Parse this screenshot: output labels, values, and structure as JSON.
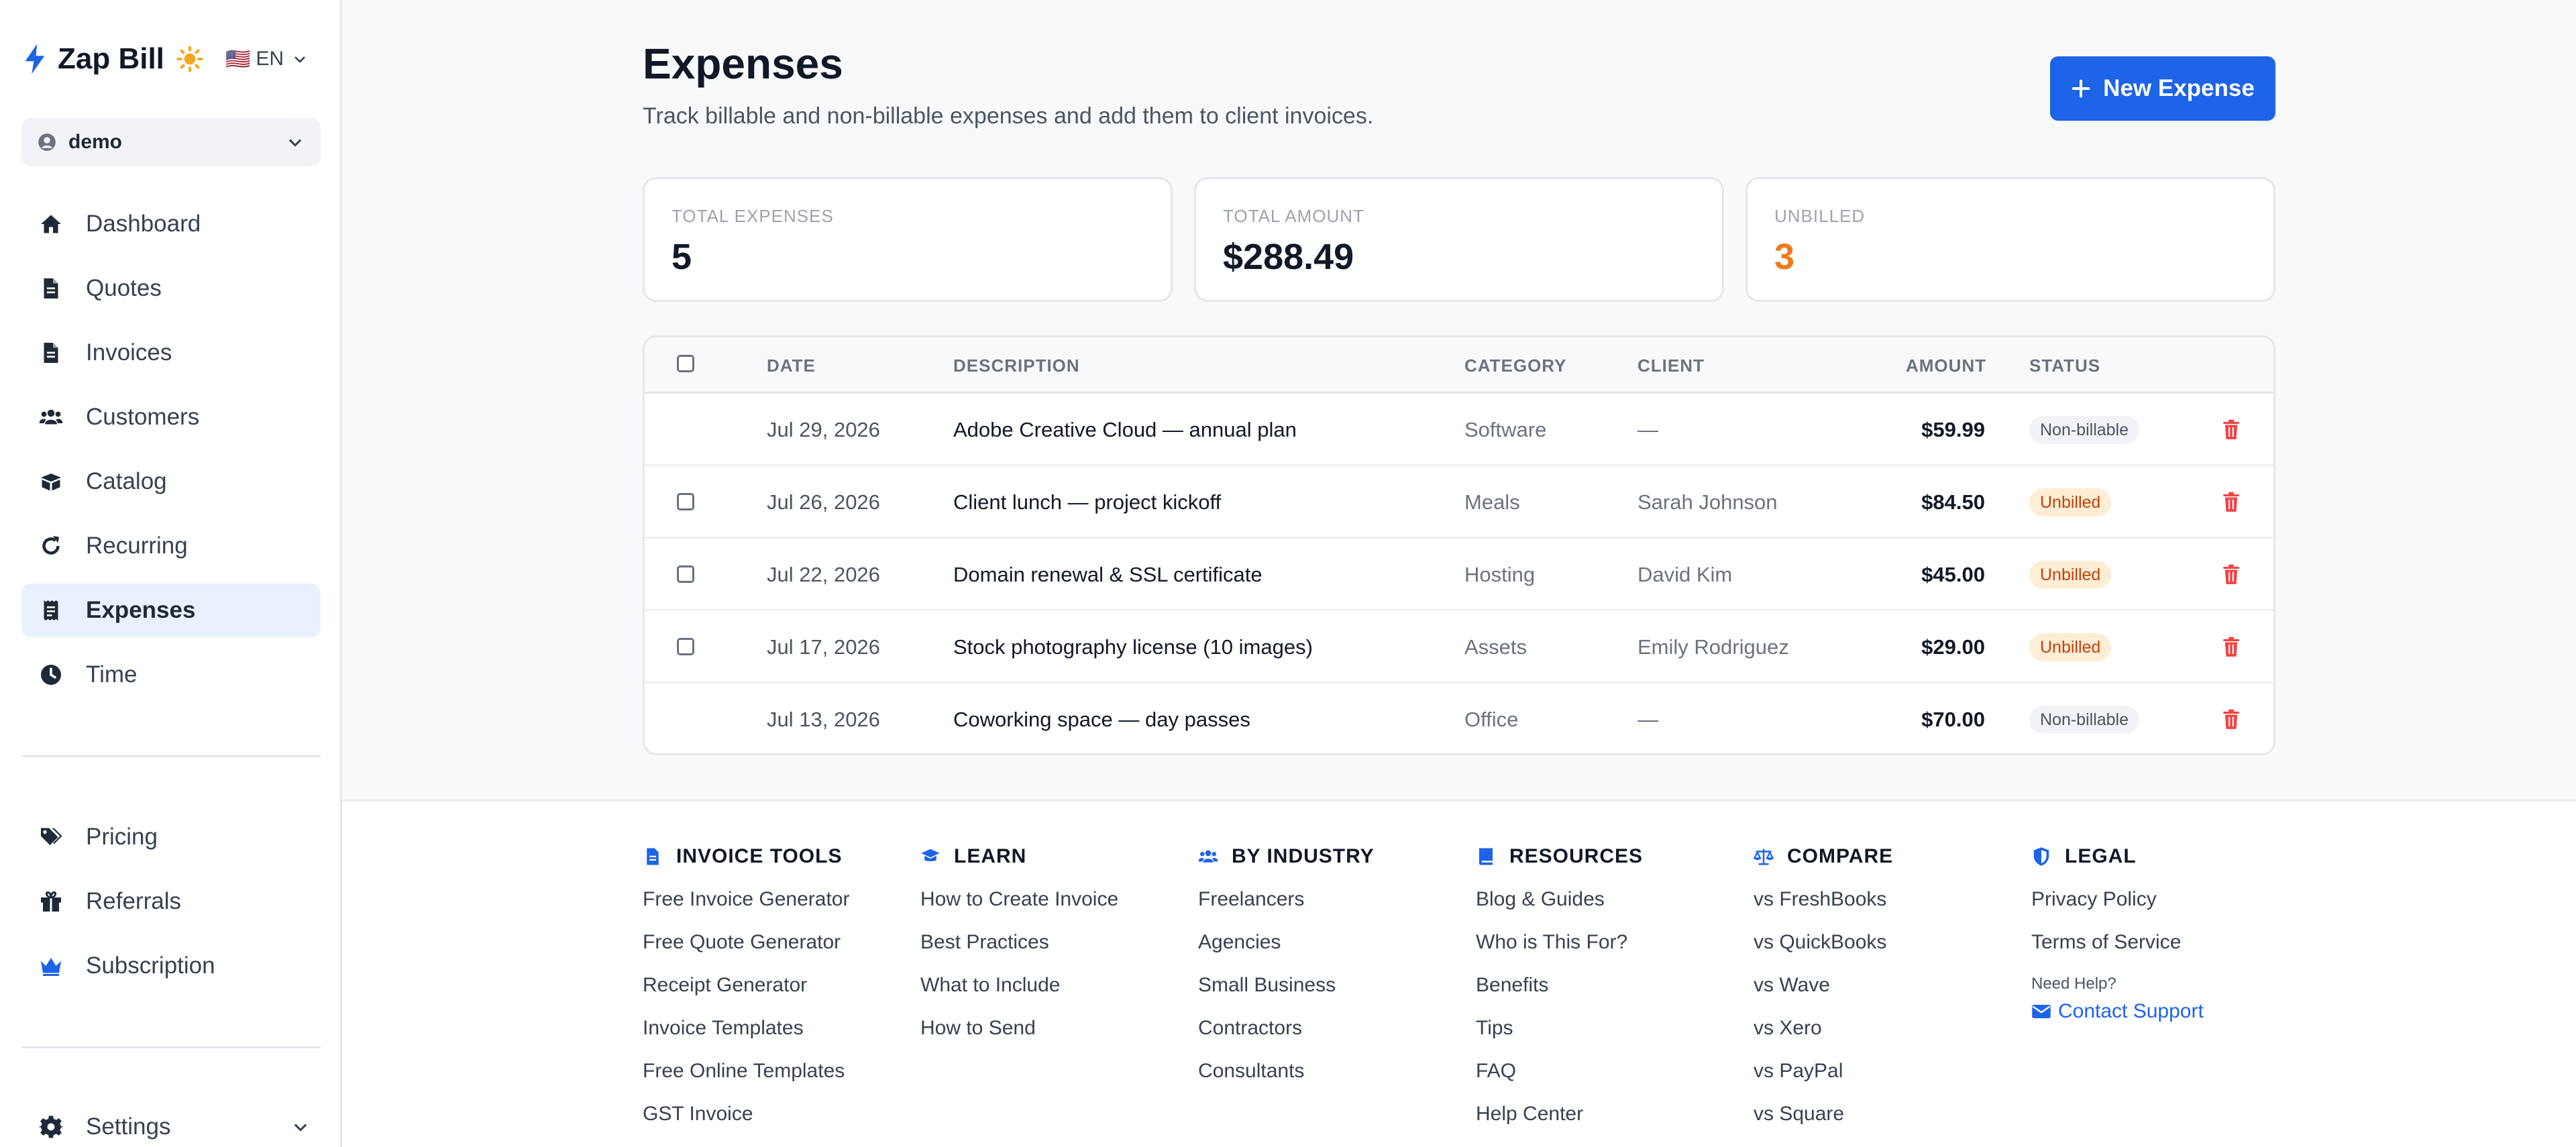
{
  "app": {
    "name": "Zap Bill",
    "language": "EN",
    "language_flag": "🇺🇸"
  },
  "org": {
    "label": "demo"
  },
  "nav": {
    "primary": [
      {
        "label": "Dashboard",
        "icon": "home-icon"
      },
      {
        "label": "Quotes",
        "icon": "file-icon"
      },
      {
        "label": "Invoices",
        "icon": "file-icon"
      },
      {
        "label": "Customers",
        "icon": "users-icon"
      },
      {
        "label": "Catalog",
        "icon": "box-icon"
      },
      {
        "label": "Recurring",
        "icon": "refresh-icon"
      },
      {
        "label": "Expenses",
        "icon": "receipt-icon",
        "active": true
      },
      {
        "label": "Time",
        "icon": "clock-icon"
      }
    ],
    "secondary": [
      {
        "label": "Pricing",
        "icon": "tags-icon"
      },
      {
        "label": "Referrals",
        "icon": "gift-icon"
      },
      {
        "label": "Subscription",
        "icon": "crown-icon"
      }
    ],
    "settings": {
      "label": "Settings"
    }
  },
  "page": {
    "title": "Expenses",
    "subtitle": "Track billable and non-billable expenses and add them to client invoices.",
    "new_button": "New Expense"
  },
  "stats": [
    {
      "label": "TOTAL EXPENSES",
      "value": "5"
    },
    {
      "label": "TOTAL AMOUNT",
      "value": "$288.49"
    },
    {
      "label": "UNBILLED",
      "value": "3",
      "accent": "#f07a1a"
    }
  ],
  "table": {
    "headers": {
      "date": "DATE",
      "description": "DESCRIPTION",
      "category": "CATEGORY",
      "client": "CLIENT",
      "amount": "AMOUNT",
      "status": "STATUS"
    },
    "rows": [
      {
        "date": "Jul 29, 2026",
        "description": "Adobe Creative Cloud — annual plan",
        "category": "Software",
        "client": "—",
        "amount": "$59.99",
        "status": "Non-billable",
        "selectable": false
      },
      {
        "date": "Jul 26, 2026",
        "description": "Client lunch — project kickoff",
        "category": "Meals",
        "client": "Sarah Johnson",
        "amount": "$84.50",
        "status": "Unbilled",
        "selectable": true
      },
      {
        "date": "Jul 22, 2026",
        "description": "Domain renewal & SSL certificate",
        "category": "Hosting",
        "client": "David Kim",
        "amount": "$45.00",
        "status": "Unbilled",
        "selectable": true
      },
      {
        "date": "Jul 17, 2026",
        "description": "Stock photography license (10 images)",
        "category": "Assets",
        "client": "Emily Rodriguez",
        "amount": "$29.00",
        "status": "Unbilled",
        "selectable": true
      },
      {
        "date": "Jul 13, 2026",
        "description": "Coworking space — day passes",
        "category": "Office",
        "client": "—",
        "amount": "$70.00",
        "status": "Non-billable",
        "selectable": false
      }
    ]
  },
  "footer": {
    "columns": [
      {
        "title": "INVOICE TOOLS",
        "icon": "file-icon",
        "links": [
          "Free Invoice Generator",
          "Free Quote Generator",
          "Receipt Generator",
          "Invoice Templates",
          "Free Online Templates",
          "GST Invoice"
        ]
      },
      {
        "title": "LEARN",
        "icon": "graduation-cap-icon",
        "links": [
          "How to Create Invoice",
          "Best Practices",
          "What to Include",
          "How to Send"
        ]
      },
      {
        "title": "BY INDUSTRY",
        "icon": "users-icon",
        "links": [
          "Freelancers",
          "Agencies",
          "Small Business",
          "Contractors",
          "Consultants"
        ]
      },
      {
        "title": "RESOURCES",
        "icon": "book-icon",
        "links": [
          "Blog & Guides",
          "Who is This For?",
          "Benefits",
          "Tips",
          "FAQ",
          "Help Center"
        ]
      },
      {
        "title": "COMPARE",
        "icon": "scale-icon",
        "links": [
          "vs FreshBooks",
          "vs QuickBooks",
          "vs Wave",
          "vs Xero",
          "vs PayPal",
          "vs Square"
        ]
      },
      {
        "title": "LEGAL",
        "icon": "shield-icon",
        "links": [
          "Privacy Policy",
          "Terms of Service"
        ],
        "help_label": "Need Help?",
        "support_label": "Contact Support"
      }
    ]
  },
  "colors": {
    "accent": "#1d64e8",
    "unbilled": "#f07a1a",
    "danger": "#ef4444"
  }
}
